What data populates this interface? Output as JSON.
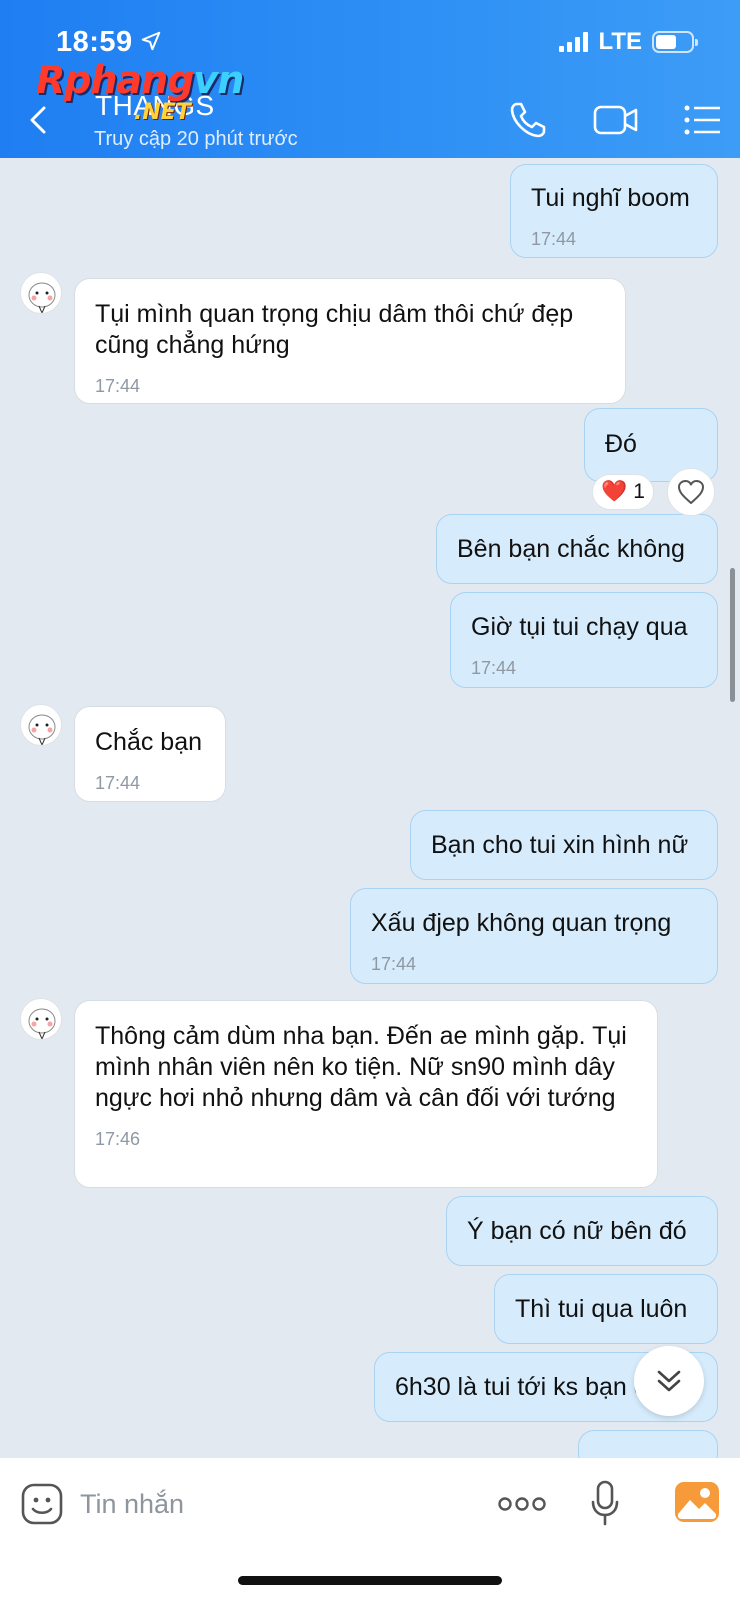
{
  "status_bar": {
    "time": "18:59",
    "network": "LTE"
  },
  "header": {
    "chat_name": "THANGS",
    "last_seen": "Truy cập 20 phút trước",
    "watermark_main": "Rphang",
    "watermark_vn": "vn",
    "watermark_net": ".NET"
  },
  "messages": [
    {
      "side": "out",
      "text": "Tui nghĩ boom",
      "time": "17:44"
    },
    {
      "side": "in",
      "text": "Tụi mình quan trọng chịu dâm thôi chứ đẹp cũng chẳng hứng",
      "time": "17:44"
    },
    {
      "side": "out",
      "text": "Đó",
      "reaction": "❤️",
      "reaction_count": "1"
    },
    {
      "side": "out",
      "text": "Bên bạn chắc không"
    },
    {
      "side": "out",
      "text": "Giờ tụi tui chạy qua",
      "time": "17:44"
    },
    {
      "side": "in",
      "text": "Chắc bạn",
      "time": "17:44"
    },
    {
      "side": "out",
      "text": "Bạn cho tui xin hình nữ"
    },
    {
      "side": "out",
      "text": "Xấu đjep không quan trọng",
      "time": "17:44"
    },
    {
      "side": "in",
      "text": "Thông cảm dùm nha bạn. Đến ae mình gặp. Tụi mình nhân viên nên ko tiện. Nữ sn90 mình dây ngực hơi nhỏ nhưng dâm và cân đối với tướng",
      "time": "17:46"
    },
    {
      "side": "out",
      "text": "Ý bạn có nữ bên đó"
    },
    {
      "side": "out",
      "text": "Thì tui qua luôn"
    },
    {
      "side": "out",
      "text": "6h30 là tui tới ks bạn chỉe"
    }
  ],
  "composer": {
    "placeholder": "Tin nhắn"
  },
  "colors": {
    "header": "#2a8cf4",
    "outgoing_bubble": "#d6ecfc",
    "incoming_bubble": "#ffffff",
    "background": "#e2e9f1"
  },
  "icons": [
    "location-arrow-icon",
    "back-chevron-icon",
    "phone-icon",
    "video-camera-icon",
    "list-menu-icon",
    "heart-icon",
    "chevron-double-down-icon",
    "sticker-face-icon",
    "more-dots-icon",
    "microphone-icon",
    "image-gallery-icon"
  ]
}
